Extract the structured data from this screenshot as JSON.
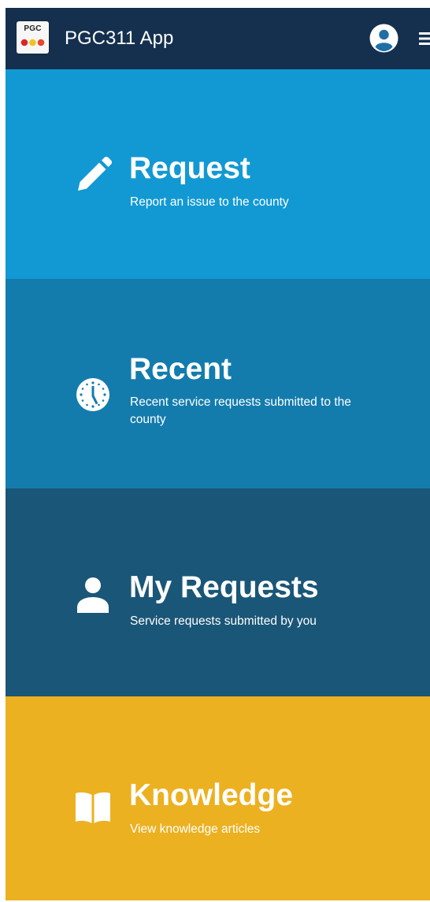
{
  "header": {
    "logo_text": "PGC",
    "title": "PGC311 App",
    "account_icon": "account-circle-icon",
    "menu_icon": "hamburger-menu-icon"
  },
  "tiles": [
    {
      "heading": "Request",
      "subtitle": "Report an issue to the county",
      "icon": "pencil-icon",
      "color": "#1299d3"
    },
    {
      "heading": "Recent",
      "subtitle": "Recent service requests submitted to the county",
      "icon": "clock-icon",
      "color": "#137cad"
    },
    {
      "heading": "My Requests",
      "subtitle": "Service requests submitted by you",
      "icon": "person-icon",
      "color": "#1a5677"
    },
    {
      "heading": "Knowledge",
      "subtitle": "View knowledge articles",
      "icon": "book-icon",
      "color": "#ecb120"
    }
  ],
  "colors": {
    "topbar": "#14304e",
    "text": "#ffffff"
  }
}
